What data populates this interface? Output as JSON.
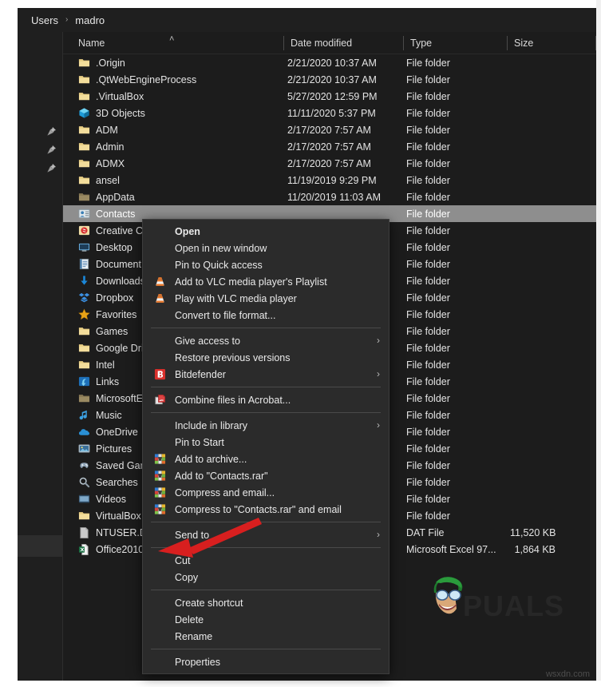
{
  "window": {
    "breadcrumb": {
      "parts": [
        "Users",
        "madro"
      ],
      "separator": "›"
    }
  },
  "columns": {
    "name": "Name",
    "date_modified": "Date modified",
    "type": "Type",
    "size": "Size",
    "sort_indicator": "˄"
  },
  "files": [
    {
      "name": ".Origin",
      "icon": "folder-icon",
      "date": "2/21/2020 10:37 AM",
      "type": "File folder",
      "size": ""
    },
    {
      "name": ".QtWebEngineProcess",
      "icon": "folder-icon",
      "date": "2/21/2020 10:37 AM",
      "type": "File folder",
      "size": ""
    },
    {
      "name": ".VirtualBox",
      "icon": "folder-icon",
      "date": "5/27/2020 12:59 PM",
      "type": "File folder",
      "size": ""
    },
    {
      "name": "3D Objects",
      "icon": "3d-objects-icon",
      "date": "11/11/2020 5:37 PM",
      "type": "File folder",
      "size": ""
    },
    {
      "name": "ADM",
      "icon": "folder-icon",
      "date": "2/17/2020 7:57 AM",
      "type": "File folder",
      "size": ""
    },
    {
      "name": "Admin",
      "icon": "folder-icon",
      "date": "2/17/2020 7:57 AM",
      "type": "File folder",
      "size": ""
    },
    {
      "name": "ADMX",
      "icon": "folder-icon",
      "date": "2/17/2020 7:57 AM",
      "type": "File folder",
      "size": ""
    },
    {
      "name": "ansel",
      "icon": "folder-icon",
      "date": "11/19/2019 9:29 PM",
      "type": "File folder",
      "size": ""
    },
    {
      "name": "AppData",
      "icon": "folder-dim-icon",
      "date": "11/20/2019 11:03 AM",
      "type": "File folder",
      "size": ""
    },
    {
      "name": "Contacts",
      "icon": "contacts-icon",
      "date": "",
      "type": "File folder",
      "size": "",
      "selected": true
    },
    {
      "name": "Creative Cl",
      "icon": "creative-cloud-icon",
      "date": "",
      "type": "File folder",
      "size": ""
    },
    {
      "name": "Desktop",
      "icon": "desktop-icon",
      "date": "",
      "type": "File folder",
      "size": ""
    },
    {
      "name": "Document",
      "icon": "documents-icon",
      "date": "",
      "type": "File folder",
      "size": ""
    },
    {
      "name": "Downloads",
      "icon": "downloads-icon",
      "date": "",
      "type": "File folder",
      "size": ""
    },
    {
      "name": "Dropbox",
      "icon": "dropbox-icon",
      "date": "",
      "type": "File folder",
      "size": ""
    },
    {
      "name": "Favorites",
      "icon": "favorites-star-icon",
      "date": "",
      "type": "File folder",
      "size": ""
    },
    {
      "name": "Games",
      "icon": "folder-icon",
      "date": "",
      "type": "File folder",
      "size": ""
    },
    {
      "name": "Google Dri",
      "icon": "folder-icon",
      "date": "",
      "type": "File folder",
      "size": ""
    },
    {
      "name": "Intel",
      "icon": "folder-icon",
      "date": "",
      "type": "File folder",
      "size": ""
    },
    {
      "name": "Links",
      "icon": "links-icon",
      "date": "",
      "type": "File folder",
      "size": ""
    },
    {
      "name": "MicrosoftE",
      "icon": "folder-dim-icon",
      "date": "",
      "type": "File folder",
      "size": ""
    },
    {
      "name": "Music",
      "icon": "music-note-icon",
      "date": "",
      "type": "File folder",
      "size": ""
    },
    {
      "name": "OneDrive",
      "icon": "onedrive-cloud-icon",
      "date": "",
      "type": "File folder",
      "size": ""
    },
    {
      "name": "Pictures",
      "icon": "pictures-icon",
      "date": "",
      "type": "File folder",
      "size": ""
    },
    {
      "name": "Saved Gam",
      "icon": "saved-games-icon",
      "date": "",
      "type": "File folder",
      "size": ""
    },
    {
      "name": "Searches",
      "icon": "search-icon",
      "date": "",
      "type": "File folder",
      "size": ""
    },
    {
      "name": "Videos",
      "icon": "videos-icon",
      "date": "",
      "type": "File folder",
      "size": ""
    },
    {
      "name": "VirtualBox",
      "icon": "folder-icon",
      "date": "",
      "type": "File folder",
      "size": ""
    },
    {
      "name": "NTUSER.DA",
      "icon": "dat-file-icon",
      "date": "",
      "type": "DAT File",
      "size": "11,520 KB"
    },
    {
      "name": "Office2010",
      "icon": "excel-file-icon",
      "date": "",
      "type": "Microsoft Excel 97...",
      "size": "1,864 KB"
    }
  ],
  "context_menu": [
    {
      "label": "Open",
      "icon": null,
      "bold": true,
      "submenu": false
    },
    {
      "label": "Open in new window",
      "icon": null,
      "bold": false,
      "submenu": false
    },
    {
      "label": "Pin to Quick access",
      "icon": null,
      "bold": false,
      "submenu": false
    },
    {
      "label": "Add to VLC media player's Playlist",
      "icon": "vlc-cone-icon",
      "bold": false,
      "submenu": false
    },
    {
      "label": "Play with VLC media player",
      "icon": "vlc-cone-icon",
      "bold": false,
      "submenu": false
    },
    {
      "label": "Convert to file format...",
      "icon": null,
      "bold": false,
      "submenu": false
    },
    {
      "separator": true
    },
    {
      "label": "Give access to",
      "icon": null,
      "bold": false,
      "submenu": true
    },
    {
      "label": "Restore previous versions",
      "icon": null,
      "bold": false,
      "submenu": false
    },
    {
      "label": "Bitdefender",
      "icon": "bitdefender-icon",
      "bold": false,
      "submenu": true
    },
    {
      "separator": true
    },
    {
      "label": "Combine files in Acrobat...",
      "icon": "acrobat-icon",
      "bold": false,
      "submenu": false
    },
    {
      "separator": true
    },
    {
      "label": "Include in library",
      "icon": null,
      "bold": false,
      "submenu": true
    },
    {
      "label": "Pin to Start",
      "icon": null,
      "bold": false,
      "submenu": false
    },
    {
      "label": "Add to archive...",
      "icon": "winrar-icon",
      "bold": false,
      "submenu": false
    },
    {
      "label": "Add to \"Contacts.rar\"",
      "icon": "winrar-icon",
      "bold": false,
      "submenu": false
    },
    {
      "label": "Compress and email...",
      "icon": "winrar-icon",
      "bold": false,
      "submenu": false
    },
    {
      "label": "Compress to \"Contacts.rar\" and email",
      "icon": "winrar-icon",
      "bold": false,
      "submenu": false
    },
    {
      "separator": true
    },
    {
      "label": "Send to",
      "icon": null,
      "bold": false,
      "submenu": true
    },
    {
      "separator": true
    },
    {
      "label": "Cut",
      "icon": null,
      "bold": false,
      "submenu": false
    },
    {
      "label": "Copy",
      "icon": null,
      "bold": false,
      "submenu": false
    },
    {
      "separator": true
    },
    {
      "label": "Create shortcut",
      "icon": null,
      "bold": false,
      "submenu": false
    },
    {
      "label": "Delete",
      "icon": null,
      "bold": false,
      "submenu": false
    },
    {
      "label": "Rename",
      "icon": null,
      "bold": false,
      "submenu": false
    },
    {
      "separator": true
    },
    {
      "label": "Properties",
      "icon": null,
      "bold": false,
      "submenu": false
    }
  ],
  "annotations": {
    "arrow_color": "#d81f1f",
    "arrow_target": "Cut"
  },
  "watermarks": {
    "appuals": "PUALS",
    "source_site": "wsxdn.com"
  },
  "colors": {
    "background": "#1c1c1c",
    "panel": "#1f1f1f",
    "menu": "#2b2b2b",
    "selection": "#8e8e8e",
    "folder": "#f5dd9a",
    "accent_red": "#d81f1f"
  }
}
